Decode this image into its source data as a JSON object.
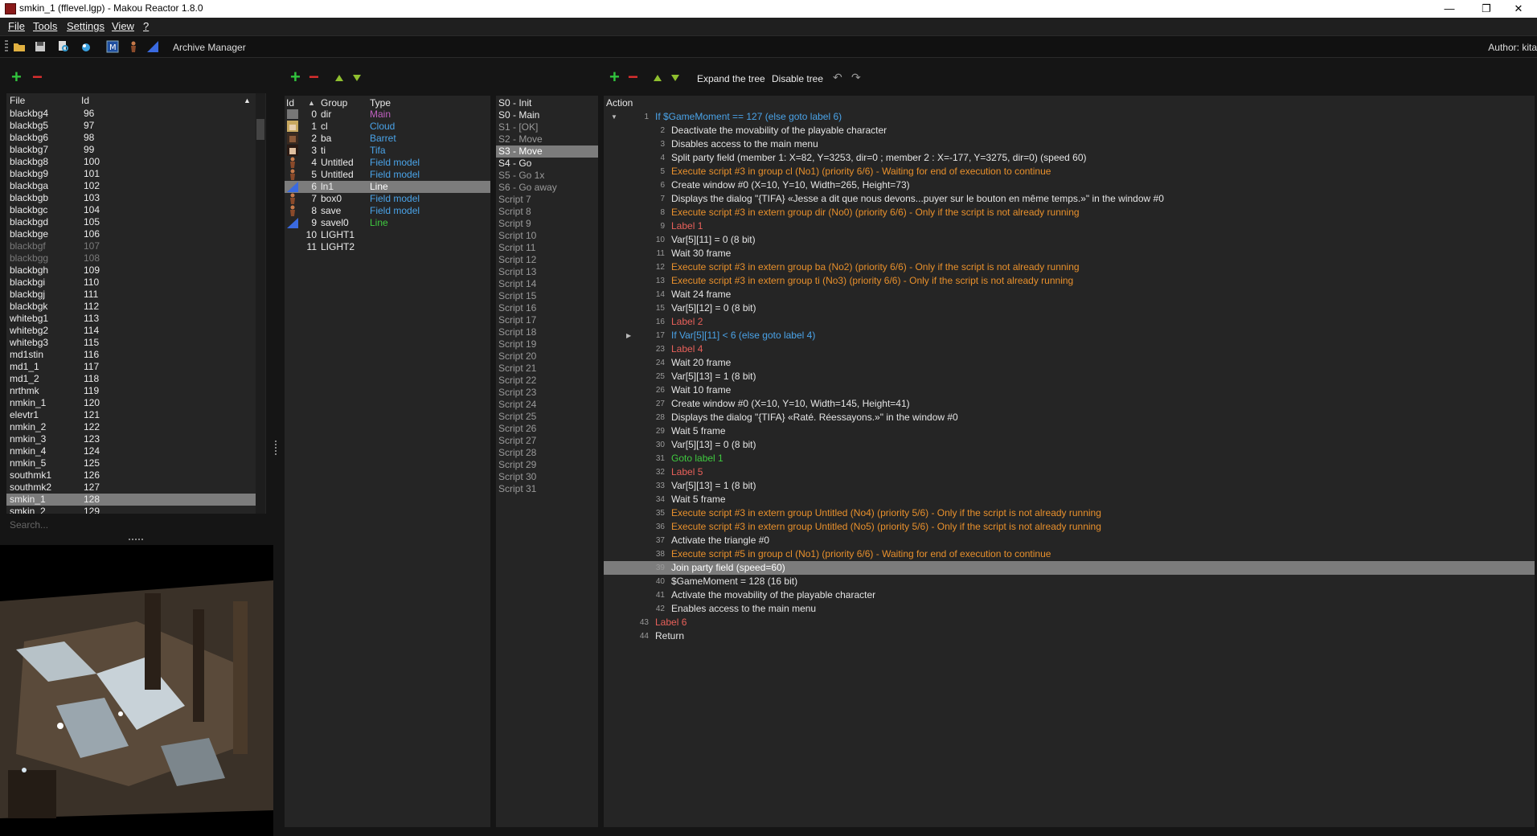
{
  "window": {
    "title": "smkin_1 (fflevel.lgp) - Makou Reactor 1.8.0",
    "minimize": "—",
    "maximize": "❐",
    "close": "✕"
  },
  "menu": [
    "File",
    "Tools",
    "Settings",
    "View",
    "?"
  ],
  "toolbar": {
    "archive_manager": "Archive Manager",
    "author": "Author: kita"
  },
  "colors": {
    "main": "#c060c0",
    "cloud": "#4aa3e8",
    "field_model": "#4aa3e8",
    "line": "#3fc93f",
    "exec": "#e8902c",
    "label": "#e8605a",
    "goto": "#3fc93f",
    "if": "#4aa3e8",
    "disabled": "#7a7a7a",
    "selected": "#7c7c7c"
  },
  "file_list": {
    "header_file": "File",
    "header_id": "Id",
    "sort_indicator": "▲",
    "search_placeholder": "Search...",
    "items": [
      {
        "file": "blackbg4",
        "id": "96"
      },
      {
        "file": "blackbg5",
        "id": "97"
      },
      {
        "file": "blackbg6",
        "id": "98"
      },
      {
        "file": "blackbg7",
        "id": "99"
      },
      {
        "file": "blackbg8",
        "id": "100"
      },
      {
        "file": "blackbg9",
        "id": "101"
      },
      {
        "file": "blackbga",
        "id": "102"
      },
      {
        "file": "blackbgb",
        "id": "103"
      },
      {
        "file": "blackbgc",
        "id": "104"
      },
      {
        "file": "blackbgd",
        "id": "105"
      },
      {
        "file": "blackbge",
        "id": "106"
      },
      {
        "file": "blackbgf",
        "id": "107",
        "disabled": true
      },
      {
        "file": "blackbgg",
        "id": "108",
        "disabled": true
      },
      {
        "file": "blackbgh",
        "id": "109"
      },
      {
        "file": "blackbgi",
        "id": "110"
      },
      {
        "file": "blackbgj",
        "id": "111"
      },
      {
        "file": "blackbgk",
        "id": "112"
      },
      {
        "file": "whitebg1",
        "id": "113"
      },
      {
        "file": "whitebg2",
        "id": "114"
      },
      {
        "file": "whitebg3",
        "id": "115"
      },
      {
        "file": "md1stin",
        "id": "116"
      },
      {
        "file": "md1_1",
        "id": "117"
      },
      {
        "file": "md1_2",
        "id": "118"
      },
      {
        "file": "nrthmk",
        "id": "119"
      },
      {
        "file": "nmkin_1",
        "id": "120"
      },
      {
        "file": "elevtr1",
        "id": "121"
      },
      {
        "file": "nmkin_2",
        "id": "122"
      },
      {
        "file": "nmkin_3",
        "id": "123"
      },
      {
        "file": "nmkin_4",
        "id": "124"
      },
      {
        "file": "nmkin_5",
        "id": "125"
      },
      {
        "file": "southmk1",
        "id": "126"
      },
      {
        "file": "southmk2",
        "id": "127"
      },
      {
        "file": "smkin_1",
        "id": "128",
        "selected": true
      },
      {
        "file": "smkin_2",
        "id": "129"
      }
    ]
  },
  "groups": {
    "header_id": "Id",
    "header_group": "Group",
    "header_type": "Type",
    "sort_indicator": "▲",
    "items": [
      {
        "id": "0",
        "group": "dir",
        "type": "Main",
        "type_color": "#c060c0",
        "icon": "generic-model-icon"
      },
      {
        "id": "1",
        "group": "cl",
        "type": "Cloud",
        "type_color": "#4aa3e8",
        "icon": "cloud-portrait-icon"
      },
      {
        "id": "2",
        "group": "ba",
        "type": "Barret",
        "type_color": "#4aa3e8",
        "icon": "barret-portrait-icon"
      },
      {
        "id": "3",
        "group": "ti",
        "type": "Tifa",
        "type_color": "#4aa3e8",
        "icon": "tifa-portrait-icon"
      },
      {
        "id": "4",
        "group": "Untitled",
        "type": "Field model",
        "type_color": "#4aa3e8",
        "icon": "field-model-icon"
      },
      {
        "id": "5",
        "group": "Untitled",
        "type": "Field model",
        "type_color": "#4aa3e8",
        "icon": "field-model-icon"
      },
      {
        "id": "6",
        "group": "ln1",
        "type": "Line",
        "type_color": "#3fc93f",
        "icon": "line-icon",
        "selected": true
      },
      {
        "id": "7",
        "group": "box0",
        "type": "Field model",
        "type_color": "#4aa3e8",
        "icon": "field-model-icon"
      },
      {
        "id": "8",
        "group": "save",
        "type": "Field model",
        "type_color": "#4aa3e8",
        "icon": "field-model-icon"
      },
      {
        "id": "9",
        "group": "savel0",
        "type": "Line",
        "type_color": "#3fc93f",
        "icon": "line-icon"
      },
      {
        "id": "10",
        "group": "LIGHT1",
        "type": "",
        "type_color": "#4aa3e8",
        "icon": ""
      },
      {
        "id": "11",
        "group": "LIGHT2",
        "type": "",
        "type_color": "#4aa3e8",
        "icon": ""
      }
    ]
  },
  "scripts": {
    "items": [
      {
        "label": "S0 - Init"
      },
      {
        "label": "S0 - Main"
      },
      {
        "label": "S1 - [OK]",
        "dim": true
      },
      {
        "label": "S2 - Move",
        "dim": true
      },
      {
        "label": "S3 - Move",
        "selected": true
      },
      {
        "label": "S4 - Go"
      },
      {
        "label": "S5 - Go 1x",
        "dim": true
      },
      {
        "label": "S6 - Go away",
        "dim": true
      },
      {
        "label": "Script 7",
        "dim": true
      },
      {
        "label": "Script 8",
        "dim": true
      },
      {
        "label": "Script 9",
        "dim": true
      },
      {
        "label": "Script 10",
        "dim": true
      },
      {
        "label": "Script 11",
        "dim": true
      },
      {
        "label": "Script 12",
        "dim": true
      },
      {
        "label": "Script 13",
        "dim": true
      },
      {
        "label": "Script 14",
        "dim": true
      },
      {
        "label": "Script 15",
        "dim": true
      },
      {
        "label": "Script 16",
        "dim": true
      },
      {
        "label": "Script 17",
        "dim": true
      },
      {
        "label": "Script 18",
        "dim": true
      },
      {
        "label": "Script 19",
        "dim": true
      },
      {
        "label": "Script 20",
        "dim": true
      },
      {
        "label": "Script 21",
        "dim": true
      },
      {
        "label": "Script 22",
        "dim": true
      },
      {
        "label": "Script 23",
        "dim": true
      },
      {
        "label": "Script 24",
        "dim": true
      },
      {
        "label": "Script 25",
        "dim": true
      },
      {
        "label": "Script 26",
        "dim": true
      },
      {
        "label": "Script 27",
        "dim": true
      },
      {
        "label": "Script 28",
        "dim": true
      },
      {
        "label": "Script 29",
        "dim": true
      },
      {
        "label": "Script 30",
        "dim": true
      },
      {
        "label": "Script 31",
        "dim": true
      }
    ]
  },
  "actions": {
    "header": "Action",
    "expand_tree": "Expand the tree",
    "disable_tree": "Disable tree",
    "items": [
      {
        "num": "1",
        "text": "If $GameMoment == 127 (else goto label 6)",
        "color": "#4aa3e8",
        "indent": 0,
        "expander": "▼"
      },
      {
        "num": "2",
        "text": "Deactivate the movability of the playable character",
        "color": "#e4e4e4",
        "indent": 1
      },
      {
        "num": "3",
        "text": "Disables access to the main menu",
        "color": "#e4e4e4",
        "indent": 1
      },
      {
        "num": "4",
        "text": "Split party field (member 1: X=82, Y=3253, dir=0 ; member 2 : X=-177, Y=3275, dir=0) (speed 60)",
        "color": "#e4e4e4",
        "indent": 1
      },
      {
        "num": "5",
        "text": "Execute script #3 in group cl (No1) (priority 6/6) - Waiting for end of execution to continue",
        "color": "#e8902c",
        "indent": 1
      },
      {
        "num": "6",
        "text": "Create window #0 (X=10, Y=10, Width=265, Height=73)",
        "color": "#e4e4e4",
        "indent": 1
      },
      {
        "num": "7",
        "text": "Displays the dialog \"{TIFA} «Jesse a dit que nous devons...puyer sur le bouton en même temps.»\" in the window #0",
        "color": "#e4e4e4",
        "indent": 1
      },
      {
        "num": "8",
        "text": "Execute script #3 in extern group dir (No0) (priority 6/6) - Only if the script is not already running",
        "color": "#e8902c",
        "indent": 1
      },
      {
        "num": "9",
        "text": "Label 1",
        "color": "#e8605a",
        "indent": 1
      },
      {
        "num": "10",
        "text": "Var[5][11] = 0 (8 bit)",
        "color": "#e4e4e4",
        "indent": 1
      },
      {
        "num": "11",
        "text": "Wait 30 frame",
        "color": "#e4e4e4",
        "indent": 1
      },
      {
        "num": "12",
        "text": "Execute script #3 in extern group ba (No2) (priority 6/6) - Only if the script is not already running",
        "color": "#e8902c",
        "indent": 1
      },
      {
        "num": "13",
        "text": "Execute script #3 in extern group ti (No3) (priority 6/6) - Only if the script is not already running",
        "color": "#e8902c",
        "indent": 1
      },
      {
        "num": "14",
        "text": "Wait 24 frame",
        "color": "#e4e4e4",
        "indent": 1
      },
      {
        "num": "15",
        "text": "Var[5][12] = 0 (8 bit)",
        "color": "#e4e4e4",
        "indent": 1
      },
      {
        "num": "16",
        "text": "Label 2",
        "color": "#e8605a",
        "indent": 1
      },
      {
        "num": "17",
        "text": "If Var[5][11] < 6 (else goto label 4)",
        "color": "#4aa3e8",
        "indent": 1,
        "expander": "▶"
      },
      {
        "num": "23",
        "text": "Label 4",
        "color": "#e8605a",
        "indent": 1
      },
      {
        "num": "24",
        "text": "Wait 20 frame",
        "color": "#e4e4e4",
        "indent": 1
      },
      {
        "num": "25",
        "text": "Var[5][13] = 1 (8 bit)",
        "color": "#e4e4e4",
        "indent": 1
      },
      {
        "num": "26",
        "text": "Wait 10 frame",
        "color": "#e4e4e4",
        "indent": 1
      },
      {
        "num": "27",
        "text": "Create window #0 (X=10, Y=10, Width=145, Height=41)",
        "color": "#e4e4e4",
        "indent": 1
      },
      {
        "num": "28",
        "text": "Displays the dialog \"{TIFA} «Raté. Réessayons.»\" in the window #0",
        "color": "#e4e4e4",
        "indent": 1
      },
      {
        "num": "29",
        "text": "Wait 5 frame",
        "color": "#e4e4e4",
        "indent": 1
      },
      {
        "num": "30",
        "text": "Var[5][13] = 0 (8 bit)",
        "color": "#e4e4e4",
        "indent": 1
      },
      {
        "num": "31",
        "text": "Goto label 1",
        "color": "#3fc93f",
        "indent": 1
      },
      {
        "num": "32",
        "text": "Label 5",
        "color": "#e8605a",
        "indent": 1
      },
      {
        "num": "33",
        "text": "Var[5][13] = 1 (8 bit)",
        "color": "#e4e4e4",
        "indent": 1
      },
      {
        "num": "34",
        "text": "Wait 5 frame",
        "color": "#e4e4e4",
        "indent": 1
      },
      {
        "num": "35",
        "text": "Execute script #3 in extern group Untitled (No4) (priority 5/6) - Only if the script is not already running",
        "color": "#e8902c",
        "indent": 1
      },
      {
        "num": "36",
        "text": "Execute script #3 in extern group Untitled (No5) (priority 5/6) - Only if the script is not already running",
        "color": "#e8902c",
        "indent": 1
      },
      {
        "num": "37",
        "text": "Activate the triangle #0",
        "color": "#e4e4e4",
        "indent": 1
      },
      {
        "num": "38",
        "text": "Execute script #5 in group cl (No1) (priority 6/6) - Waiting for end of execution to continue",
        "color": "#e8902c",
        "indent": 1
      },
      {
        "num": "39",
        "text": "Join party field (speed=60)",
        "color": "#ffffff",
        "indent": 1,
        "selected": true
      },
      {
        "num": "40",
        "text": "$GameMoment = 128 (16 bit)",
        "color": "#e4e4e4",
        "indent": 1
      },
      {
        "num": "41",
        "text": "Activate the movability of the playable character",
        "color": "#e4e4e4",
        "indent": 1
      },
      {
        "num": "42",
        "text": "Enables access to the main menu",
        "color": "#e4e4e4",
        "indent": 1
      },
      {
        "num": "43",
        "text": "Label 6",
        "color": "#e8605a",
        "indent": 0
      },
      {
        "num": "44",
        "text": "Return",
        "color": "#e4e4e4",
        "indent": 0
      }
    ]
  }
}
